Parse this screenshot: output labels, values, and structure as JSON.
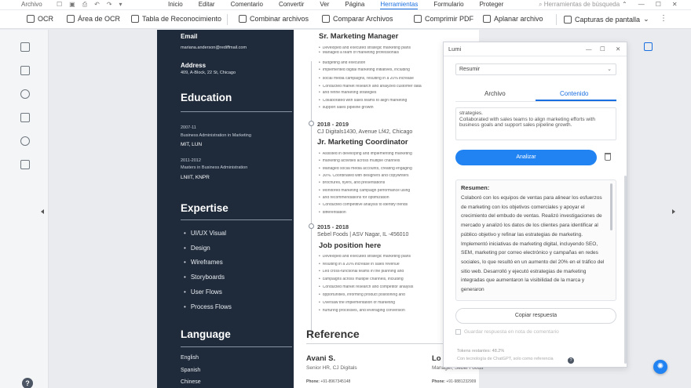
{
  "menubar": {
    "file": "Archivo",
    "menus": [
      "Inicio",
      "Editar",
      "Comentario",
      "Convertir",
      "Ver",
      "Página",
      "Herramientas",
      "Formulario",
      "Proteger"
    ],
    "active_menu": "Herramientas",
    "search_placeholder": "Herramientas de búsqueda"
  },
  "toolbar": {
    "items": [
      "OCR",
      "Área de OCR",
      "Tabla de Reconocimiento",
      "Combinar archivos",
      "Comparar Archivos",
      "Comprimir PDF",
      "Aplanar archivo",
      "Capturas de pantalla"
    ]
  },
  "resume": {
    "email_label": "Email",
    "email": "mariana.anderson@rediffmail.com",
    "address_label": "Address",
    "address": "409, A-Block, 22 St, Chicago",
    "education_heading": "Education",
    "edu1_years": "2007-11",
    "edu1_degree": "Business Administration in Marketing",
    "edu1_school": "MIT, LUN",
    "edu2_years": "2011-2012",
    "edu2_degree": "Masters in Business Administration",
    "edu2_school": "LNIIT, KNPR",
    "expertise_heading": "Expertise",
    "skills": [
      "UI/UX Visual",
      "Design",
      "Wireframes",
      "Storyboards",
      "User Flows",
      "Process Flows"
    ],
    "language_heading": "Language",
    "languages": [
      "English",
      "Spanish",
      "Chinese"
    ],
    "job1_title": "Sr. Marketing Manager",
    "job1_bullets": [
      "Developed and executed strategic marketing plans",
      "Managed a team of marketing professionals",
      "budgeting and execution",
      "Implemented digital marketing initiatives, including",
      "social media campaigns, resulting in a 20% increase",
      "Conducted market research and analyzed customer data",
      "and refine marketing strategies",
      "Collaborated with sales teams to align marketing",
      "support sales pipeline growth"
    ],
    "job2_dates": "2018 - 2019",
    "job2_company": "CJ Digitals1430, Avenue Lf42, Chicago",
    "job2_title": "Jr. Marketing Coordinator",
    "job2_bullets": [
      "Assisted in developing and implementing marketing",
      "marketing activities across multiple channels",
      "Managed social media accounts, creating engaging",
      "30%. Coordinated with designers and copywriters",
      "brochures, flyers, and presentations",
      "Monitored marketing campaign performance using",
      "and recommendations for optimization",
      "Conducted competitive analysis to identify trends",
      "differentiation"
    ],
    "job3_dates": "2015 - 2018",
    "job3_company": "Sebel Foods | ASV Nagar, IL -456010",
    "job3_title": "Job position here",
    "job3_bullets": [
      "Developed and executed strategic marketing plans",
      "resulting in a 20% increase in sales revenue",
      "Led cross-functional teams in the planning and",
      "campaigns across multiple channels, including",
      "Conducted market research and competitor analysis",
      "opportunities, informing product positioning and",
      "Oversaw the implementation of marketing",
      "nurturing processes, and leveraging conversion"
    ],
    "reference_heading": "Reference",
    "ref1_name": "Avani S.",
    "ref1_role": "Senior HR, CJ Digitals",
    "ref1_phone_label": "Phone:",
    "ref1_phone": "+91-8967345148",
    "ref2_name": "Lo",
    "ref2_role": "Manager, Sebel Foods",
    "ref2_phone_label": "Phone:",
    "ref2_phone": "+91-9881232909"
  },
  "lumi": {
    "title": "Lumi",
    "dropdown_value": "Resumir",
    "tab_file": "Archivo",
    "tab_content": "Contenido",
    "input_text": "strategies.\nCollaborated with sales teams to align marketing efforts with business goals and support sales pipeline growth.",
    "analyze_button": "Analizar",
    "summary_heading": "Resumen:",
    "summary_text": "Colaboró con los equipos de ventas para alinear los esfuerzos de marketing con los objetivos comerciales y apoyar el crecimiento del embudo de ventas. Realizó investigaciones de mercado y analizó los datos de los clientes para identificar al público objetivo y refinar las estrategias de marketing. Implementó iniciativas de marketing digital, incluyendo SEO, SEM, marketing por correo electrónico y campañas en redes sociales, lo que resultó en un aumento del 20% en el tráfico del sitio web. Desarrolló y ejecutó estrategias de marketing integradas que aumentaron la visibilidad de la marca y generaron",
    "copy_button": "Copiar respuesta",
    "save_checkbox": "Guardar respuesta en nota de comentario",
    "tokens": "Tokens restantes: 48.2%",
    "footer": "Con tecnología de ChatGPT, solo como referencia"
  },
  "colors": {
    "accent": "#1a6fe0",
    "resume_sidebar": "#1f2b3b",
    "button": "#2183f2"
  }
}
